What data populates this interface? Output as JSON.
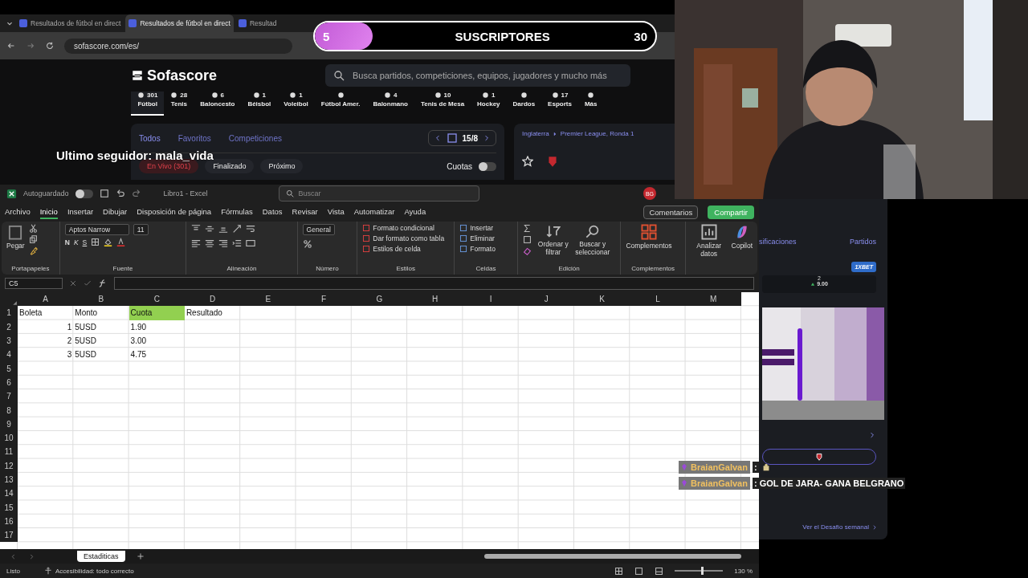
{
  "browser": {
    "tabs": [
      {
        "title": "Resultados de fútbol en direct",
        "selected": false
      },
      {
        "title": "Resultados de fútbol en direct",
        "selected": true
      },
      {
        "title": "Resultad",
        "selected": false
      }
    ],
    "address": "sofascore.com/es/"
  },
  "sofascore": {
    "logo": "Sofascore",
    "search_placeholder": "Busca partidos, competiciones, equipos, jugadores y mucho más",
    "sports": [
      {
        "count": "301",
        "label": "Fútbol",
        "selected": true
      },
      {
        "count": "28",
        "label": "Tenis",
        "selected": false
      },
      {
        "count": "6",
        "label": "Baloncesto",
        "selected": false
      },
      {
        "count": "1",
        "label": "Béisbol",
        "selected": false
      },
      {
        "count": "1",
        "label": "Voleibol",
        "selected": false
      },
      {
        "label": "Fútbol Amer.",
        "selected": false
      },
      {
        "count": "4",
        "label": "Balonmano",
        "selected": false
      },
      {
        "count": "10",
        "label": "Tenis de Mesa",
        "selected": false
      },
      {
        "count": "1",
        "label": "Hockey",
        "selected": false
      },
      {
        "label": "Dardos",
        "selected": false
      },
      {
        "count": "17",
        "label": "Esports",
        "selected": false
      },
      {
        "label": "Más",
        "selected": false
      }
    ],
    "view_tabs": [
      {
        "label": "Todos",
        "selected": true
      },
      {
        "label": "Favoritos",
        "selected": false
      },
      {
        "label": "Competiciones",
        "selected": false
      }
    ],
    "date": "15/8",
    "filters": [
      {
        "label": "En Vivo (301)",
        "kind": "live"
      },
      {
        "label": "Finalizado",
        "kind": "plain"
      },
      {
        "label": "Próximo",
        "kind": "plain"
      }
    ],
    "odds_toggle": {
      "label": "Cuotas",
      "on": false
    },
    "league": {
      "country": "Inglaterra",
      "name": "Premier League, Ronda 1"
    }
  },
  "excel": {
    "autosave": {
      "label": "Autoguardado",
      "on": false
    },
    "title": "Libro1 - Excel",
    "search_placeholder": "Buscar",
    "user": "BG",
    "menu": [
      {
        "label": "Archivo",
        "selected": false
      },
      {
        "label": "Inicio",
        "selected": true
      },
      {
        "label": "Insertar",
        "selected": false
      },
      {
        "label": "Dibujar",
        "selected": false
      },
      {
        "label": "Disposición de página",
        "selected": false
      },
      {
        "label": "Fórmulas",
        "selected": false
      },
      {
        "label": "Datos",
        "selected": false
      },
      {
        "label": "Revisar",
        "selected": false
      },
      {
        "label": "Vista",
        "selected": false
      },
      {
        "label": "Automatizar",
        "selected": false
      },
      {
        "label": "Ayuda",
        "selected": false
      }
    ],
    "comments": "Comentarios",
    "share": "Compartir",
    "ribbon": {
      "paste": "Pegar",
      "clipboard": "Portapapeles",
      "font_name": "Aptos Narrow",
      "font_size": "11",
      "bold": "N",
      "italic": "K",
      "underline": "S",
      "font": "Fuente",
      "alignment": "Alineación",
      "number_format": "General",
      "number": "Número",
      "styles": [
        "Formato condicional",
        "Dar formato como tabla",
        "Estilos de celda"
      ],
      "styles_group": "Estilos",
      "cells": [
        "Insertar",
        "Eliminar",
        "Formato"
      ],
      "cells_group": "Celdas",
      "editing": [
        "Ordenar y filtrar",
        "Buscar y seleccionar"
      ],
      "editing_group": "Edición",
      "addins": "Complementos",
      "addins_group": "Complementos",
      "analyze": "Analizar datos",
      "copilot": "Copilot"
    },
    "name_box": "C5",
    "columns": [
      "A",
      "B",
      "C",
      "D",
      "E",
      "F",
      "G",
      "H",
      "I",
      "J",
      "K",
      "L",
      "M"
    ],
    "rows": [
      {
        "number": "1",
        "cells": [
          {
            "text": "Boleta",
            "kind": "text"
          },
          {
            "text": "Monto",
            "kind": "text"
          },
          {
            "text": "Cuota",
            "kind": "text",
            "color": "#92d050"
          },
          {
            "text": "Resultado",
            "kind": "text"
          }
        ]
      },
      {
        "number": "2",
        "cells": [
          {
            "text": "1",
            "kind": "number"
          },
          {
            "text": "5USD",
            "kind": "text"
          },
          {
            "text": "1.90",
            "kind": "text"
          }
        ]
      },
      {
        "number": "3",
        "cells": [
          {
            "text": "2",
            "kind": "number"
          },
          {
            "text": "5USD",
            "kind": "text"
          },
          {
            "text": "3.00",
            "kind": "text"
          }
        ]
      },
      {
        "number": "4",
        "cells": [
          {
            "text": "3",
            "kind": "number"
          },
          {
            "text": "5USD",
            "kind": "text"
          },
          {
            "text": "4.75",
            "kind": "text"
          }
        ]
      },
      {
        "number": "5",
        "cells": []
      },
      {
        "number": "6",
        "cells": []
      },
      {
        "number": "7",
        "cells": []
      },
      {
        "number": "8",
        "cells": []
      },
      {
        "number": "9",
        "cells": []
      },
      {
        "number": "10",
        "cells": []
      },
      {
        "number": "11",
        "cells": []
      },
      {
        "number": "12",
        "cells": []
      },
      {
        "number": "13",
        "cells": []
      },
      {
        "number": "14",
        "cells": []
      },
      {
        "number": "15",
        "cells": []
      },
      {
        "number": "16",
        "cells": []
      },
      {
        "number": "17",
        "cells": []
      }
    ],
    "sheet_tab": "Estaditicas",
    "status": "Listo",
    "accessibility": "Accesibilidad: todo correcto",
    "zoom": {
      "level": 0.55,
      "reading": "130 %"
    }
  },
  "side_panel": {
    "tabs": [
      "sificaciones",
      "Partidos"
    ],
    "bookmaker": "1XBET",
    "odd_label": "2",
    "odd_value": "9.00",
    "challenge_link": "Ver el Desafío semanal"
  },
  "overlay": {
    "subscribers": {
      "current": "5",
      "label": "SUSCRIPTORES",
      "goal": "30",
      "level": 0.17
    },
    "last_follower": "Ultimo seguidor: mala_vida",
    "chat": [
      {
        "user": "BraianGalvan",
        "text": ":",
        "kind": "emote"
      },
      {
        "user": "BraianGalvan",
        "text": ": GOL DE JARA- GANA BELGRANO",
        "kind": "text"
      }
    ]
  }
}
